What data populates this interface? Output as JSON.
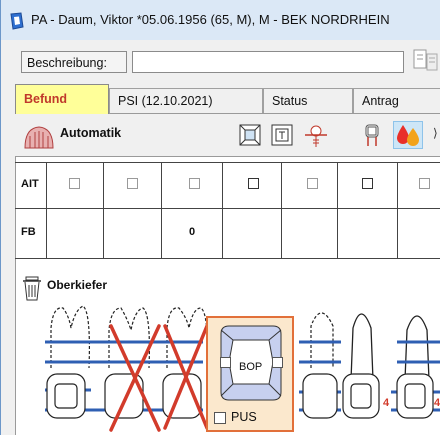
{
  "window": {
    "title": "PA - Daum, Viktor  *05.06.1956 (65, M),  M - BEK NORDRHEIN"
  },
  "description": {
    "label": "Beschreibung:",
    "value": ""
  },
  "tabs": [
    {
      "label": "Befund",
      "active": true
    },
    {
      "label": "PSI (12.10.2021)",
      "active": false
    },
    {
      "label": "Status",
      "active": false
    },
    {
      "label": "Antrag",
      "active": false
    }
  ],
  "toolbar": {
    "mode_label": "Automatik",
    "tools": [
      "furcation-icon",
      "mobility-icon",
      "implant-icon",
      "crown-icon",
      "bleeding-icon"
    ]
  },
  "grid": {
    "rows": [
      {
        "label": "AIT"
      },
      {
        "label": "FB",
        "values": [
          "",
          "",
          "0",
          "",
          "",
          "",
          ""
        ]
      }
    ]
  },
  "jaw": {
    "label": "Oberkiefer",
    "tooth_numbers": [
      "4",
      "4"
    ]
  },
  "popup": {
    "bop_label": "BOP",
    "pus_label": "PUS"
  },
  "colors": {
    "active_tab_bg": "#ffff99",
    "active_tab_text": "#c0392b",
    "popup_border": "#e2703a",
    "popup_bg": "#fbe8cd",
    "gum_line": "#2f5fb3",
    "extraction_mark": "#d23b2b",
    "tooth_number": "#d23b2b"
  }
}
